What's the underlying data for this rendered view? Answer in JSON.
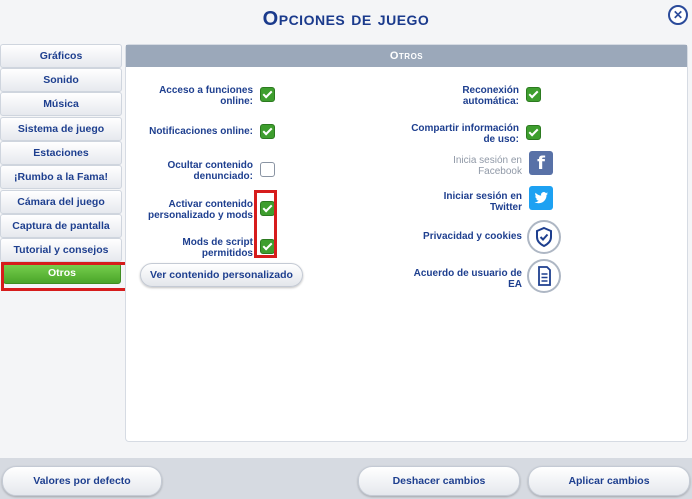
{
  "title": "Opciones de juego",
  "close_glyph": "✕",
  "sidebar": {
    "items": [
      {
        "label": "Gráficos"
      },
      {
        "label": "Sonido"
      },
      {
        "label": "Música"
      },
      {
        "label": "Sistema de juego"
      },
      {
        "label": "Estaciones"
      },
      {
        "label": "¡Rumbo a la Fama!"
      },
      {
        "label": "Cámara del juego"
      },
      {
        "label": "Captura de pantalla"
      },
      {
        "label": "Tutorial y consejos"
      },
      {
        "label": "Otros",
        "active": true
      }
    ]
  },
  "panel": {
    "header": "Otros",
    "left_options": [
      {
        "label_line1": "Acceso a funciones",
        "label_line2": "online:",
        "checked": true
      },
      {
        "label_line1": "Notificaciones online:",
        "label_line2": "",
        "checked": true
      },
      {
        "label_line1": "Ocultar contenido",
        "label_line2": "denunciado:",
        "checked": false
      },
      {
        "label_line1": "Activar contenido",
        "label_line2": "personalizado y mods",
        "checked": true
      },
      {
        "label_line1": "Mods de script",
        "label_line2": "permitidos",
        "checked": true
      }
    ],
    "view_custom_button": "Ver contenido personalizado",
    "right_options": [
      {
        "label_line1": "Reconexión",
        "label_line2": "automática:",
        "checked": true
      },
      {
        "label_line1": "Compartir información",
        "label_line2": "de uso:",
        "checked": true
      }
    ],
    "social": [
      {
        "label_line1": "Inicia sesión en",
        "label_line2": "Facebook",
        "icon": "facebook-icon",
        "glyph": "f",
        "color": "#3b5998",
        "disabled": true
      },
      {
        "label_line1": "Iniciar sesión en",
        "label_line2": "Twitter",
        "icon": "twitter-icon",
        "glyph": "🐦",
        "color": "#1da1f2",
        "disabled": false
      }
    ],
    "links": [
      {
        "label_line1": "Privacidad y cookies",
        "label_line2": "",
        "icon": "shield-check-icon"
      },
      {
        "label_line1": "Acuerdo de usuario de",
        "label_line2": "EA",
        "icon": "document-icon"
      }
    ]
  },
  "footer": {
    "defaults_button": "Valores por defecto",
    "undo_button": "Deshacer cambios",
    "apply_button": "Aplicar cambios"
  },
  "colors": {
    "accent_green": "#4aa52a",
    "highlight_red": "#d61c1c",
    "text_blue": "#1e3f8f"
  }
}
